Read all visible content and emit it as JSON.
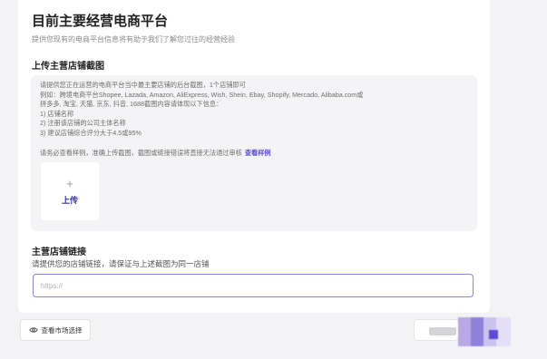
{
  "page": {
    "title": "目前主要经营电商平台",
    "subtitle": "提供您现有的电商平台信息将有助于我们了解您过往的经营经验"
  },
  "screenshot_section": {
    "title": "上传主营店铺截图",
    "lines": [
      "请提供您正在运营的电商平台当中最主要店铺的后台截图，1个店铺即可",
      "例如：跨境电商平台Shopee, Lazada, Amazon, AliExpress, Wish, Shein, Ebay, Shopify, Mercado, Alibaba.com或",
      "拼多多, 淘宝, 天猫, 京东, 抖音, 1688截图内容请体现以下信息：",
      "1) 店铺名称",
      "2) 注册该店铺的公司主体名称",
      "3) 建议店铺综合评分大于4.5或95%"
    ],
    "notice": "请务必查看样例，准确上传截图，截图或链接错误将直接无法通过审核",
    "sample_link": "查看样例",
    "upload_plus": "+",
    "upload_label": "上传"
  },
  "link_section": {
    "title": "主营店铺链接",
    "description": "请提供您的店铺链接，请保证与上述截图为同一店铺",
    "input_placeholder": "https://",
    "input_value": ""
  },
  "footer": {
    "market_button": "查看市场选择",
    "market_icon": "eye-icon"
  },
  "colors": {
    "accent": "#5b4bd8",
    "input_border": "#8c86d6",
    "background": "#f3f3f5"
  }
}
